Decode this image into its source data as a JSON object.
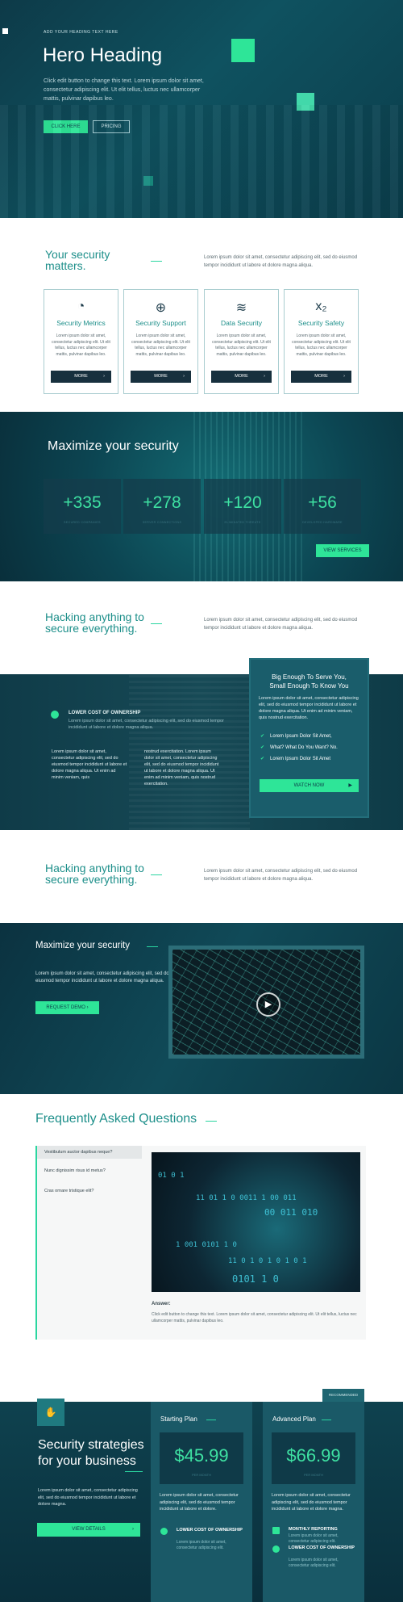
{
  "hero": {
    "kicker": "ADD YOUR HEADING TEXT HERE",
    "title": "Hero Heading",
    "text": "Click edit button to change this text. Lorem ipsum dolor sit amet, consectetur adipiscing elit. Ut elit tellus, luctus nec ullamcorper mattis, pulvinar dapibus leo.",
    "btn_primary": "CLICK HERE",
    "btn_secondary": "PRICING"
  },
  "security": {
    "title_line1": "Your security",
    "title_line2": "matters.",
    "text": "Lorem ipsum dolor sit amet, consectetur adipiscing elit, sed do eiusmod tempor incididunt ut labore et dolore magna aliqua.",
    "cards": [
      {
        "icon": "speedometer-icon",
        "glyph": "◔",
        "title": "Security Metrics",
        "text": "Lorem ipsum dolor sit amet, consectetur adipiscing elit. Ut elit tellus, luctus nec ullamcorper mattis, pulvinar dapibus leo.",
        "button": "MORE"
      },
      {
        "icon": "lifebuoy-icon",
        "glyph": "⊕",
        "title": "Security Support",
        "text": "Lorem ipsum dolor sit amet, consectetur adipiscing elit. Ut elit tellus, luctus nec ullamcorper mattis, pulvinar dapibus leo.",
        "button": "MORE"
      },
      {
        "icon": "stack-overflow-icon",
        "glyph": "≋",
        "title": "Data Security",
        "text": "Lorem ipsum dolor sit amet, consectetur adipiscing elit. Ut elit tellus, luctus nec ullamcorper mattis, pulvinar dapibus leo.",
        "button": "MORE"
      },
      {
        "icon": "subscript-icon",
        "glyph": "x₂",
        "title": "Security Safety",
        "text": "Lorem ipsum dolor sit amet, consectetur adipiscing elit. Ut elit tellus, luctus nec ullamcorper mattis, pulvinar dapibus leo.",
        "button": "MORE"
      }
    ]
  },
  "stats": {
    "title": "Maximize your security",
    "items": [
      {
        "value": "+335",
        "label": "SECURED COMPANIES"
      },
      {
        "value": "+278",
        "label": "SERVER CONNECTIONS"
      },
      {
        "value": "+120",
        "label": "ELIMINATED THREATS"
      },
      {
        "value": "+56",
        "label": "DEVELOPED HARDWARE"
      }
    ],
    "button": "VIEW SERVICES"
  },
  "hacking1": {
    "title_line1": "Hacking anything to",
    "title_line2": "secure everything.",
    "text": "Lorem ipsum dolor sit amet, consectetur adipiscing elit, sed do eiusmod tempor incididunt ut labore et dolore magna aliqua."
  },
  "ownership": {
    "item_title": "LOWER COST OF OWNERSHIP",
    "item_text": "Lorem ipsum dolor sit amet, consectetur adipiscing elit, sed do eiusmod tempor incididunt ut labore et dolore magna aliqua.",
    "col1": "Lorem ipsum dolor sit amet, consectetur adipiscing elit, sed do eiusmod tempor incididunt ut labore et dolore magna aliqua. Ut enim ad minim veniam, quis",
    "col2": "nostrud exercitation. Lorem ipsum dolor sit amet, consectetur adipiscing elit, sed do eiusmod tempor incididunt ut labore et dolore magna aliqua. Ut enim ad minim veniam, quis nostrud exercitation.",
    "panel": {
      "title_line1": "Big Enough To Serve You,",
      "title_line2": "Small Enough To Know You",
      "text": "Lorem ipsum dolor sit amet, consectetur adipiscing elit, sed do eiusmod tempor incididunt ut labore et dolore magna aliqua. Ut enim ad minim veniam, quis nostrud exercitation.",
      "list": [
        "Lorem Ipsum Dolor Sit Amet,",
        "What? What Do You Want? No.",
        "Lorem Ipsum Dolor Sit Amet"
      ],
      "button": "WATCH NOW"
    }
  },
  "hacking2": {
    "title_line1": "Hacking anything to",
    "title_line2": "secure everything.",
    "text": "Lorem ipsum dolor sit amet, consectetur adipiscing elit, sed do eiusmod tempor incididunt ut labore et dolore magna aliqua."
  },
  "video": {
    "title": "Maximize your security",
    "text": "Lorem ipsum dolor sit amet, consectetur adipiscing elit, sed do eiusmod tempor incididunt ut labore et dolore magna aliqua.",
    "button": "REQUEST DEMO"
  },
  "faq": {
    "title": "Frequently Asked Questions",
    "questions": [
      "Vestibulum auctor dapibus neque?",
      "Nunc dignissim risus id metus?",
      "Cras ornare tristique elit?"
    ],
    "binary": [
      "01 0 1",
      "11 01 1 0 0011 1 00 011",
      "00 011 010",
      "1 001 0101 1 0",
      "11 0 1 0 1 0 1 0 1",
      "0101 1 0"
    ],
    "answer_heading": "Answer:",
    "answer_text": "Click edit button to change this text. Lorem ipsum dolor sit amet, consectetur adipiscing elit. Ut elit tellus, luctus nec ullamcorper mattis, pulvinar dapibus leo."
  },
  "pricing": {
    "badge_icon": "handshake-icon",
    "title": "Security strategies for your business",
    "text": "Lorem ipsum dolor sit amet, consectetur adipiscing elit, sed do eiusmod tempor incididunt ut labore et dolore magna.",
    "button": "VIEW DETAILS",
    "recommended": "RECOMMENDED",
    "plans": [
      {
        "name": "Starting Plan",
        "price": "$45.99",
        "per": "PER MONTH",
        "text": "Lorem ipsum dolor sit amet, consectetur adipiscing elit, sed do eiusmod tempor incididunt ut labore et dolore.",
        "features": [
          {
            "title": "LOWER COST OF OWNERSHIP",
            "text": "Lorem ipsum dolor sit amet, consectetur adipiscing elit."
          }
        ]
      },
      {
        "name": "Advanced Plan",
        "price": "$66.99",
        "per": "PER MONTH",
        "text": "Lorem ipsum dolor sit amet, consectetur adipiscing elit, sed do eiusmod tempor incididunt ut labore et dolore magna.",
        "features": [
          {
            "title": "MONTHLY REPORTING",
            "text": "Lorem ipsum dolor sit amet, consectetur adipiscing elit."
          },
          {
            "title": "LOWER COST OF OWNERSHIP",
            "text": "Lorem ipsum dolor sit amet, consectetur adipiscing elit."
          }
        ]
      }
    ]
  },
  "colors": {
    "accent": "#2ee598",
    "teal": "#1d8f8a",
    "dark": "#0d3a48"
  }
}
